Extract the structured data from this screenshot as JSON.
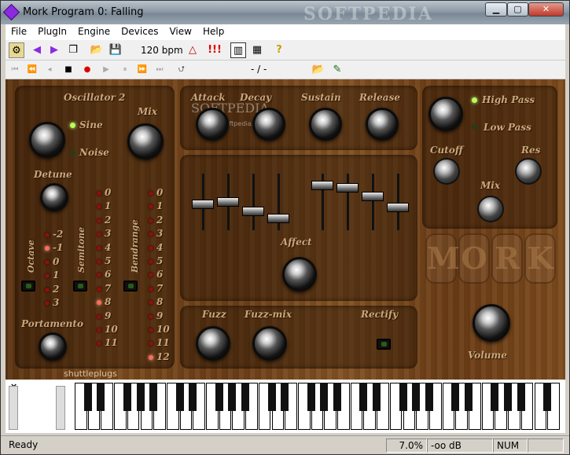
{
  "window": {
    "title": "Mork Program 0: Falling",
    "watermark": "SOFTPEDIA"
  },
  "menu": [
    "File",
    "PlugIn",
    "Engine",
    "Devices",
    "View",
    "Help"
  ],
  "toolbar": {
    "bpm": "120 bpm",
    "alert_marks": "!!!",
    "help": "?"
  },
  "transport": {
    "position": "- / -"
  },
  "osc": {
    "title": "Oscillator 2",
    "mix": "Mix",
    "sine": "Sine",
    "noise": "Noise",
    "detune": "Detune",
    "octave": "Octave",
    "semitone": "Semitone",
    "bendrange": "Bendrange",
    "portamento": "Portamento",
    "brand": "shuttleplugs",
    "octave_values": [
      "-2",
      "-1",
      "0",
      "1",
      "2",
      "3"
    ],
    "semitone_values": [
      "0",
      "1",
      "2",
      "3",
      "4",
      "5",
      "6",
      "7",
      "8",
      "9",
      "10",
      "11"
    ],
    "bend_values": [
      "0",
      "1",
      "2",
      "3",
      "4",
      "5",
      "6",
      "7",
      "8",
      "9",
      "10",
      "11",
      "12"
    ]
  },
  "env": {
    "attack": "Attack",
    "decay": "Decay",
    "sustain": "Sustain",
    "release": "Release",
    "watermark": "SOFTPEDIA",
    "url": "www.softpedia.com"
  },
  "affect": {
    "label": "Affect",
    "fader_levels": [
      0.45,
      0.5,
      0.3,
      0.15,
      0.85,
      0.8,
      0.62,
      0.38
    ]
  },
  "fx": {
    "fuzz": "Fuzz",
    "fuzz_mix": "Fuzz-mix",
    "rectify": "Rectify"
  },
  "filter": {
    "high_pass": "High Pass",
    "low_pass": "Low Pass",
    "cutoff": "Cutoff",
    "res": "Res",
    "mix": "Mix"
  },
  "logo": [
    "M",
    "O",
    "R",
    "K"
  ],
  "volume": "Volume",
  "keyboard": {
    "close": "×"
  },
  "status": {
    "ready": "Ready",
    "cpu": "7.0%",
    "level": "-oo dB",
    "num": "NUM"
  }
}
